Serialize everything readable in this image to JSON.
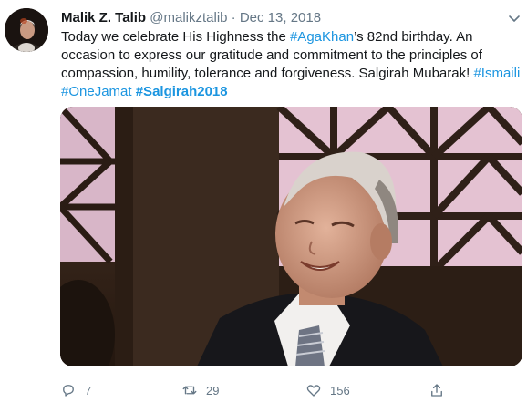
{
  "tweet": {
    "author_name": "Malik Z. Talib",
    "handle": "@malikztalib",
    "separator": "·",
    "date": "Dec 13, 2018",
    "line1_a": "Today we celebrate His Highness the ",
    "line1_tag": "#AgaKhan",
    "line1_b": "’s 82nd birthday. An",
    "line2": "occasion to express our gratitude and commitment to the principles of",
    "line3_a": "compassion, humility, tolerance and forgiveness. Salgirah Mubarak! ",
    "line3_tag": "#Ismaili",
    "line4_tag1": "#OneJamat",
    "line4_tag2": "#Salgirah2018"
  },
  "actions": {
    "reply_count": "7",
    "retweet_count": "29",
    "like_count": "156"
  },
  "icons": {
    "avatar": "author-avatar",
    "more": "chevron-down-icon",
    "reply": "reply-icon",
    "retweet": "retweet-icon",
    "like": "heart-icon",
    "share": "share-icon"
  },
  "colors": {
    "link": "#1b95e0",
    "secondary_text": "#657786",
    "primary_text": "#14171a"
  }
}
